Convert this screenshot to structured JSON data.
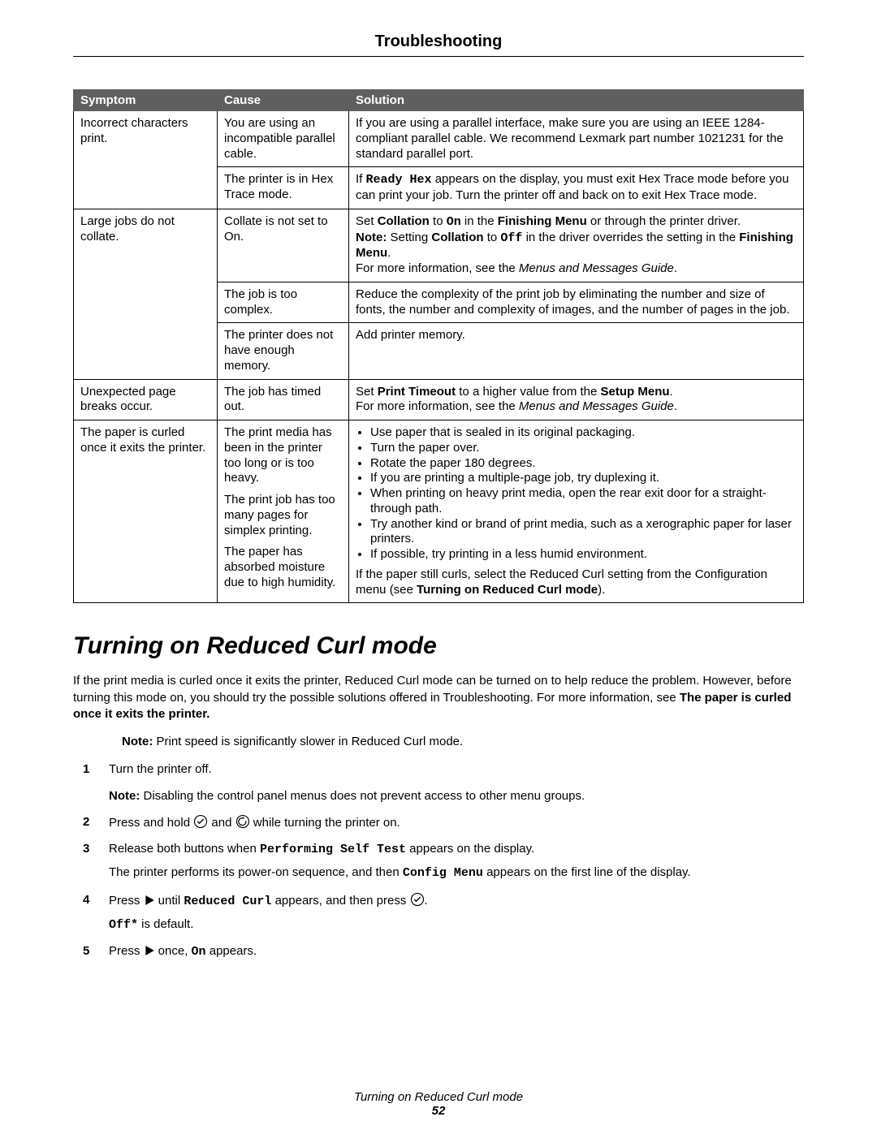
{
  "header": "Troubleshooting",
  "table": {
    "cols": [
      "Symptom",
      "Cause",
      "Solution"
    ],
    "rows": [
      {
        "symptom": "Incorrect characters print.",
        "cells": [
          {
            "cause": "You are using an incompatible parallel cable.",
            "solution_html": "If you are using a parallel interface, make sure you are using an IEEE 1284-compliant parallel cable. We recommend Lexmark part number 1021231 for the standard parallel port."
          },
          {
            "cause": "The printer is in Hex Trace mode.",
            "solution_html": "If <span class='mono'>Ready Hex</span> appears on the display, you must exit Hex Trace mode before you can print your job. Turn the printer off and back on to exit Hex Trace mode."
          }
        ]
      },
      {
        "symptom": "Large jobs do not collate.",
        "cells": [
          {
            "cause": "Collate is not set to On.",
            "solution_html": "Set <span class='b'>Collation</span> to <span class='mono'>On</span> in the <span class='b'>Finishing Menu</span> or through the printer driver.<br><span class='b'>Note:</span> Setting <span class='b'>Collation</span> to <span class='mono'>Off</span> in the driver overrides the setting in the <span class='b'>Finishing Menu</span>.<br>For more information, see the <span class='i'>Menus and Messages Guide</span>."
          },
          {
            "cause": "The job is too complex.",
            "solution_html": "Reduce the complexity of the print job by eliminating the number and size of fonts, the number and complexity of images, and the number of pages in the job."
          },
          {
            "cause": "The printer does not have enough memory.",
            "solution_html": "Add printer memory."
          }
        ]
      },
      {
        "symptom": "Unexpected page breaks occur.",
        "cells": [
          {
            "cause": "The job has timed out.",
            "solution_html": "Set <span class='b'>Print Timeout</span> to a higher value from the <span class='b'>Setup Menu</span>.<br>For more information, see the <span class='i'>Menus and Messages Guide</span>."
          }
        ]
      },
      {
        "symptom": "The paper is curled once it exits the printer.",
        "cause_combined": [
          "The print media has been in the printer too long or is too heavy.",
          "The print job has too many pages for simplex printing.",
          "The paper has absorbed moisture due to high humidity."
        ],
        "solution_list": [
          "Use paper that is sealed in its original packaging.",
          "Turn the paper over.",
          "Rotate the paper 180 degrees.",
          "If you are printing a multiple-page job, try duplexing it.",
          "When printing on heavy print media, open the rear exit door for a straight-through path.",
          "Try another kind or brand of print media, such as a xerographic paper for laser printers.",
          "If possible, try printing in a less humid environment."
        ],
        "solution_tail": "If the paper still curls, select the Reduced Curl setting from the Configuration menu (see <span class='b'>Turning on Reduced Curl mode</span>)."
      }
    ]
  },
  "section": {
    "title": "Turning on Reduced Curl mode",
    "intro": "If the print media is curled once it exits the printer, Reduced Curl mode can be turned on to help reduce the problem. However, before turning this mode on, you should try the possible solutions offered in Troubleshooting. For more information, see <span class='b'>The paper is curled once it exits the printer.</span>",
    "note1": "<span class='b'>Note:</span> Print speed is significantly slower in Reduced Curl mode.",
    "steps": [
      {
        "n": "1",
        "html": "Turn the printer off.",
        "sub": "<span class='b'>Note:</span> Disabling the control panel menus does not prevent access to other menu groups."
      },
      {
        "n": "2",
        "html": "Press and hold {CHECK} and {BACK} while turning the printer on."
      },
      {
        "n": "3",
        "html": "Release both buttons when <span class='mono'>Performing Self Test</span> appears on the display.",
        "sub2": "The printer performs its power-on sequence, and then <span class='mono'>Config Menu</span> appears on the first line of the display."
      },
      {
        "n": "4",
        "html": "Press {TRI} until <span class='mono'>Reduced Curl</span> appears, and then press {CHECK}.",
        "sub2": "<span class='mono'>Off*</span> is default."
      },
      {
        "n": "5",
        "html": "Press {TRI} once, <span class='mono'>On</span> appears."
      }
    ]
  },
  "footer": {
    "title": "Turning on Reduced Curl mode",
    "page": "52"
  }
}
